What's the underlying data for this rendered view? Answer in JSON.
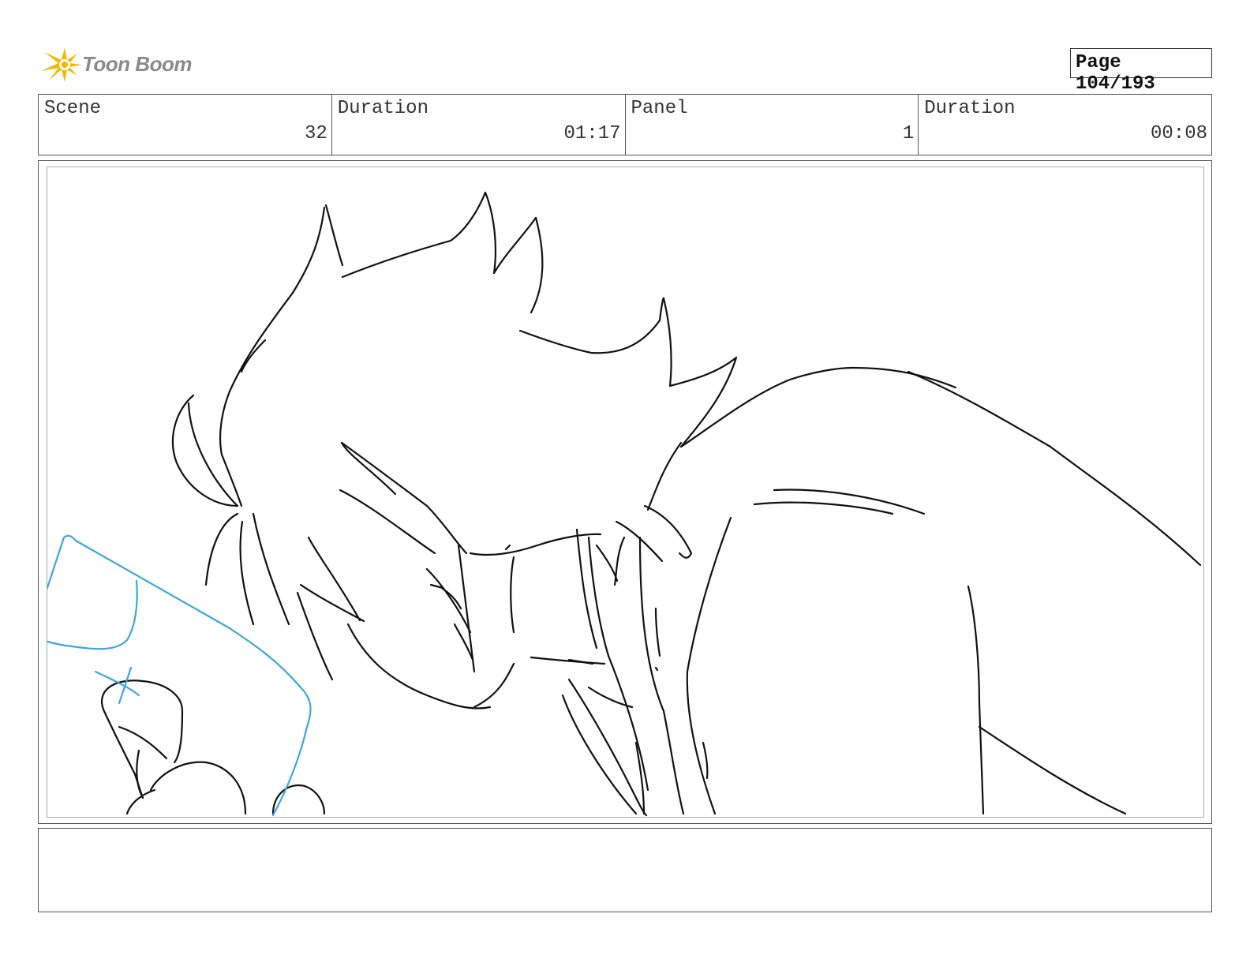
{
  "logo": {
    "text": "Toon Boom",
    "icon": "sun-burst-logo-icon",
    "accent": "#f5b800"
  },
  "page": {
    "label": "Page 104/193"
  },
  "header": {
    "scene_label": "Scene",
    "scene_value": "32",
    "duration1_label": "Duration",
    "duration1_value": "01:17",
    "panel_label": "Panel",
    "panel_value": "1",
    "duration2_label": "Duration",
    "duration2_value": "00:08"
  },
  "panel": {
    "sketch": "character-leaning-sketch",
    "line_color": "#111111",
    "blue_line_color": "#3aa6e0"
  },
  "caption": {
    "text": ""
  }
}
